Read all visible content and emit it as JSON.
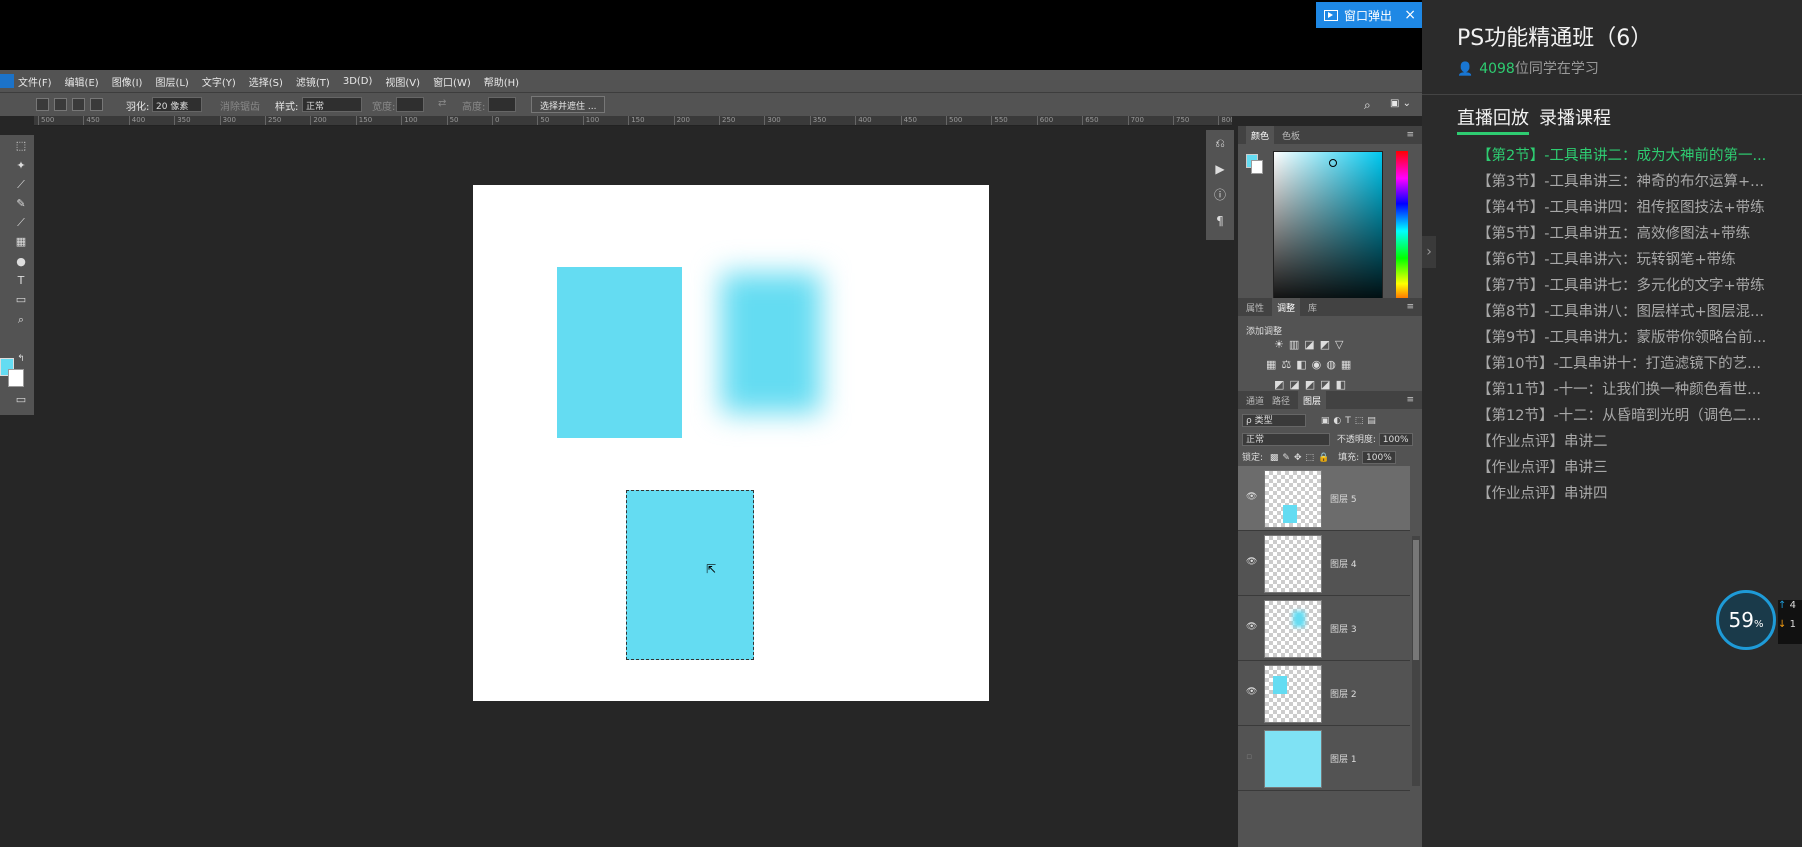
{
  "popout": {
    "label": "窗口弹出",
    "close": "×"
  },
  "menu": [
    "文件(F)",
    "编辑(E)",
    "图像(I)",
    "图层(L)",
    "文字(Y)",
    "选择(S)",
    "滤镜(T)",
    "3D(D)",
    "视图(V)",
    "窗口(W)",
    "帮助(H)"
  ],
  "options": {
    "feather_label": "羽化:",
    "feather_value": "20 像素",
    "antialias": "消除锯齿",
    "style_label": "样式:",
    "style_value": "正常",
    "width_label": "宽度:",
    "height_label": "高度:",
    "select_mask": "选择并遮住 ..."
  },
  "ruler": [
    "500",
    "450",
    "400",
    "350",
    "300",
    "250",
    "200",
    "150",
    "100",
    "50",
    "0",
    "50",
    "100",
    "150",
    "200",
    "250",
    "300",
    "350",
    "400",
    "450",
    "500",
    "550",
    "600",
    "650",
    "700",
    "750",
    "800"
  ],
  "panels": {
    "color_tabs": [
      "颜色",
      "色板"
    ],
    "adj_tabs": [
      "属性",
      "调整",
      "库"
    ],
    "adj_label": "添加调整",
    "layer_tabs": [
      "通道",
      "路径",
      "图层"
    ],
    "filter_type": "ρ 类型",
    "blend_mode": "正常",
    "opacity_label": "不透明度:",
    "opacity_value": "100%",
    "lock_label": "锁定:",
    "fill_label": "填充:",
    "fill_value": "100%"
  },
  "layers": [
    {
      "name": "图层 5",
      "selected": true
    },
    {
      "name": "图层 4",
      "selected": false
    },
    {
      "name": "图层 3",
      "selected": false
    },
    {
      "name": "图层 2",
      "selected": false
    },
    {
      "name": "图层 1",
      "selected": false
    }
  ],
  "course": {
    "title": "PS功能精通班（6）",
    "learners_count": "4098",
    "learners_suffix": "位同学在学习",
    "tab_live": "直播回放",
    "tab_recorded": "录播课程",
    "lessons": [
      {
        "text": "【第2节】-工具串讲二：成为大神前的第一...",
        "active": true
      },
      {
        "text": "【第3节】-工具串讲三：神奇的布尔运算+...",
        "active": false
      },
      {
        "text": "【第4节】-工具串讲四：祖传抠图技法+带练",
        "active": false
      },
      {
        "text": "【第5节】-工具串讲五：高效修图法+带练",
        "active": false
      },
      {
        "text": "【第6节】-工具串讲六：玩转钢笔+带练",
        "active": false
      },
      {
        "text": "【第7节】-工具串讲七：多元化的文字+带练",
        "active": false
      },
      {
        "text": "【第8节】-工具串讲八：图层样式+图层混...",
        "active": false
      },
      {
        "text": "【第9节】-工具串讲九：蒙版带你领略台前...",
        "active": false
      },
      {
        "text": "【第10节】-工具串讲十：打造滤镜下的艺...",
        "active": false
      },
      {
        "text": "【第11节】-十一：让我们换一种颜色看世...",
        "active": false
      },
      {
        "text": "【第12节】-十二：从昏暗到光明（调色二...",
        "active": false
      },
      {
        "text": "【作业点评】串讲二",
        "active": false
      },
      {
        "text": "【作业点评】串讲三",
        "active": false
      },
      {
        "text": "【作业点评】串讲四",
        "active": false
      }
    ]
  },
  "gauge": {
    "value": "59",
    "unit": "%"
  },
  "net": {
    "up": "4",
    "down": "1"
  },
  "colors": {
    "swatch": "#64dcf2",
    "accent_green": "#2ecc71",
    "popout_blue": "#1e88e5"
  }
}
